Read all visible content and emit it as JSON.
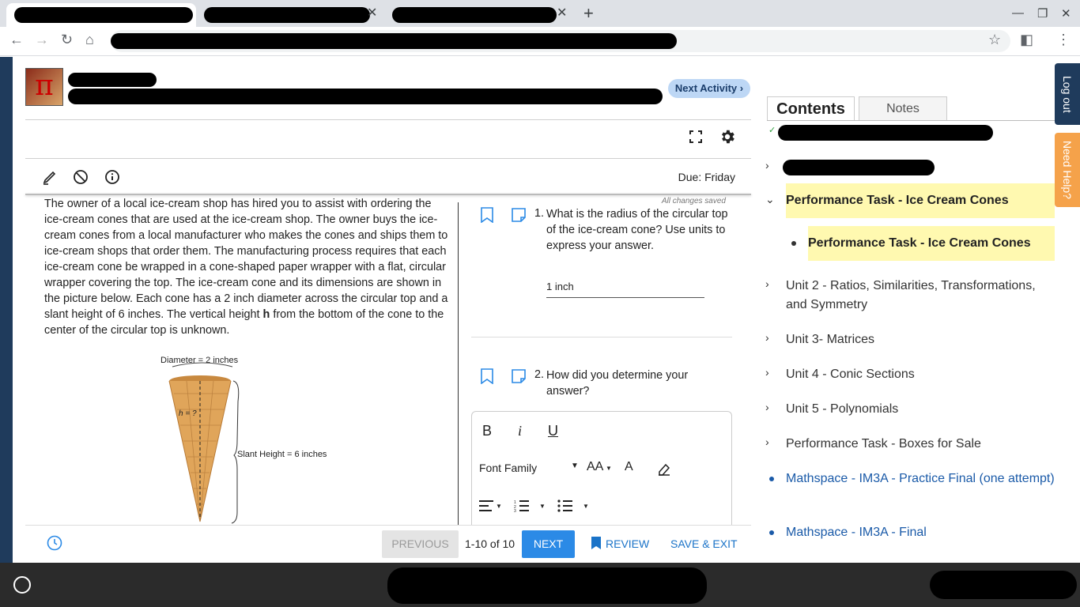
{
  "app": {
    "next_activity_label": "Next Activity ›",
    "due_label": "Due: Friday",
    "autosave_status": "All changes saved"
  },
  "passage": {
    "text": "The owner of a local ice-cream shop has hired you to assist with ordering the ice-cream cones that are used at the ice-cream shop. The owner buys the ice-cream cones from a local manufacturer who makes the cones and ships them to ice-cream shops that order them. The manufacturing process requires that each ice-cream cone be wrapped in a cone-shaped paper wrapper with a flat, circular wrapper covering the top. The ice-cream cone and its dimensions are shown in the picture below. Each cone has a 2 inch diameter across the circular top and a slant height of 6 inches. The vertical height ",
    "bold_var": "h",
    "text_end": " from the bottom of the cone to the center of the circular top is unknown.",
    "figure": {
      "diameter_label": "Diameter = 2 inches",
      "height_label": "h = ?",
      "slant_label": "Slant Height = 6 inches"
    }
  },
  "questions": [
    {
      "number": "1.",
      "text": "What is the radius of the circular top of the ice-cream cone? Use units to express your answer.",
      "answer": "1 inch"
    },
    {
      "number": "2.",
      "text": "How did you determine your answer?"
    }
  ],
  "editor": {
    "bold": "B",
    "italic": "i",
    "underline": "U",
    "font_family": "Font Family"
  },
  "footer": {
    "previous": "PREVIOUS",
    "pager": "1-10 of 10",
    "next": "NEXT",
    "review": "REVIEW",
    "save_exit": "SAVE & EXIT"
  },
  "contents_panel": {
    "tabs": [
      "Contents",
      "Notes"
    ],
    "items": [
      {
        "label": "Performance Task - Ice Cream Cones",
        "expanded": true
      },
      {
        "label": "Performance Task - Ice Cream Cones",
        "child": true
      },
      {
        "label": "Unit 2 - Ratios, Similarities, Transformations, and Symmetry"
      },
      {
        "label": "Unit 3- Matrices"
      },
      {
        "label": "Unit 4 - Conic Sections"
      },
      {
        "label": "Unit 5 - Polynomials"
      },
      {
        "label": "Performance Task - Boxes for Sale"
      },
      {
        "label": "Mathspace - IM3A - Practice Final (one attempt)"
      },
      {
        "label": "Mathspace - IM3A - Final"
      }
    ],
    "colors": {
      "highlight": "#fff9b0",
      "link": "#1a5aa8"
    }
  },
  "side_tabs": {
    "logout": "Log out",
    "need_help": "Need Help?"
  }
}
